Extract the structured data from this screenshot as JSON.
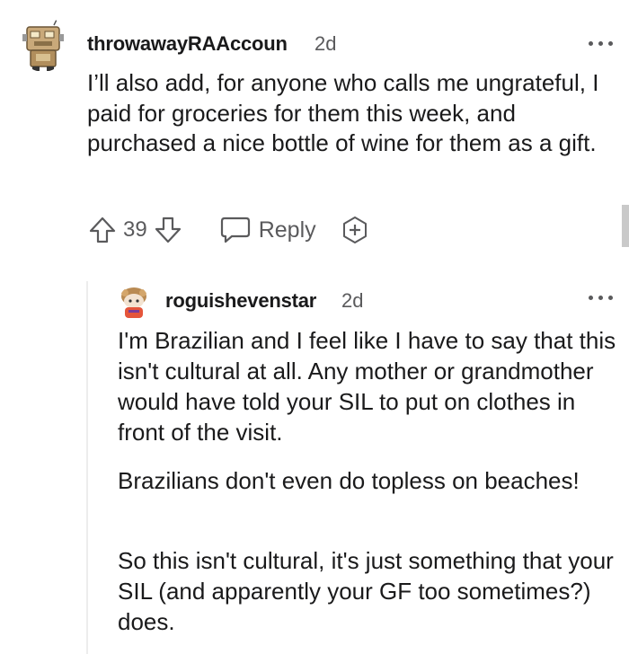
{
  "comments": [
    {
      "username": "throwawayRAAccoun",
      "time": "2d",
      "avatar": "robot-avatar-icon",
      "paragraphs": [
        "I’ll also add, for anyone who calls me ungrateful, I paid for groceries for them this week, and purchased a nice bottle of wine for them as a gift."
      ],
      "votes": "39",
      "reply_label": "Reply"
    },
    {
      "username": "roguishevenstar",
      "time": "2d",
      "avatar": "snoo-avatar-icon",
      "paragraphs": [
        "I'm Brazilian and I feel like I have to say that this isn't cultural at all. Any mother or grandmother would have told your SIL to put on clothes in front of the visit.",
        "Brazilians don't even do topless on beaches!",
        "So this isn't cultural, it's just something that your SIL (and apparently your GF too sometimes?) does."
      ]
    }
  ],
  "colors": {
    "text": "#1a1a1b",
    "meta": "#5a5a5c",
    "thread_line": "#ededed"
  }
}
